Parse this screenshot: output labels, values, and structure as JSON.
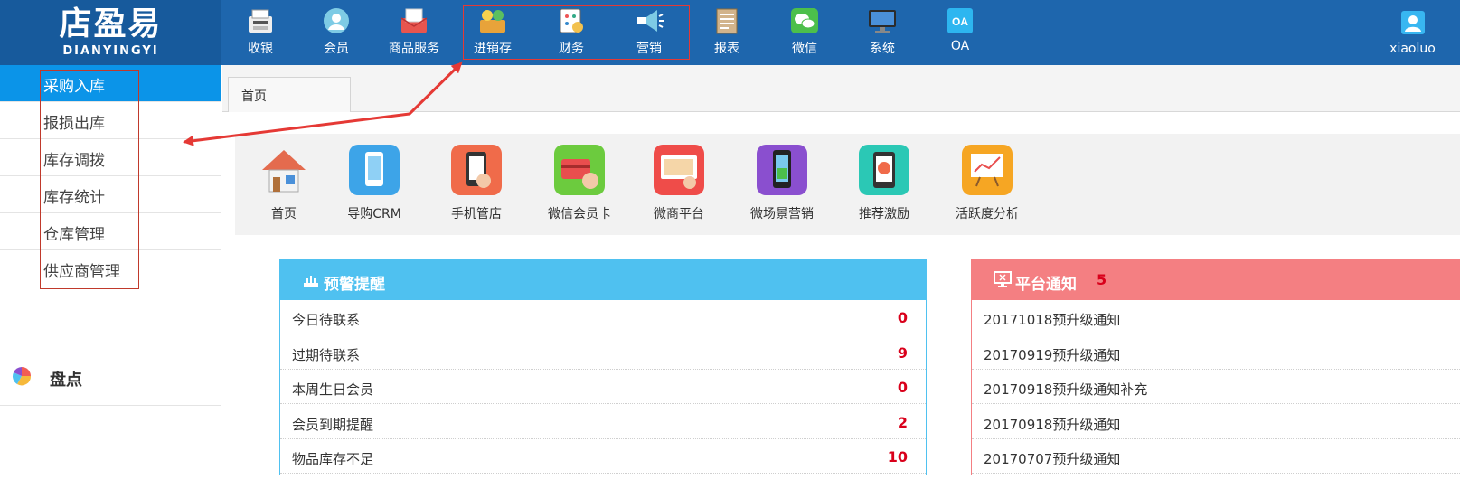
{
  "logo": {
    "main": "店盈易",
    "sub": "DIANYINGYI"
  },
  "nav": [
    {
      "label": "收银",
      "icon": "cash-register-icon",
      "color": "#f2c14e"
    },
    {
      "label": "会员",
      "icon": "member-icon",
      "color": "#7ecbe5"
    },
    {
      "label": "商品服务",
      "icon": "goods-service-icon",
      "color": "#e8554e"
    },
    {
      "label": "进销存",
      "icon": "inventory-icon",
      "color": "#e8a33a"
    },
    {
      "label": "财务",
      "icon": "finance-icon",
      "color": "#f2c14e"
    },
    {
      "label": "营销",
      "icon": "marketing-icon",
      "color": "#7ecbe5"
    },
    {
      "label": "报表",
      "icon": "report-icon",
      "color": "#d2b48c"
    },
    {
      "label": "微信",
      "icon": "wechat-icon",
      "color": "#4cbf4b"
    },
    {
      "label": "系统",
      "icon": "system-icon",
      "color": "#2b2b2b"
    },
    {
      "label": "OA",
      "icon": "oa-icon",
      "color": "#2db6f0"
    }
  ],
  "user": {
    "name": "xiaoluo"
  },
  "sidebar": {
    "items": [
      {
        "label": "采购入库"
      },
      {
        "label": "报损出库"
      },
      {
        "label": "库存调拨"
      },
      {
        "label": "库存统计"
      },
      {
        "label": "仓库管理"
      },
      {
        "label": "供应商管理"
      }
    ],
    "active_index": 0,
    "group": {
      "label": "盘点",
      "icon": "pie-chart-icon"
    }
  },
  "tabs": [
    {
      "label": "首页"
    }
  ],
  "shortcuts": [
    {
      "label": "首页",
      "icon": "home-icon",
      "color": "#e46b4e"
    },
    {
      "label": "导购CRM",
      "icon": "crm-phone-icon",
      "color": "#3da4e8"
    },
    {
      "label": "手机管店",
      "icon": "mobile-store-icon",
      "color": "#f06b4a"
    },
    {
      "label": "微信会员卡",
      "icon": "member-card-icon",
      "color": "#6ccb3e"
    },
    {
      "label": "微商平台",
      "icon": "micro-shop-icon",
      "color": "#ef4c49"
    },
    {
      "label": "微场景营销",
      "icon": "scene-marketing-icon",
      "color": "#8a4fcf"
    },
    {
      "label": "推荐激励",
      "icon": "referral-icon",
      "color": "#2bc8b5"
    },
    {
      "label": "活跃度分析",
      "icon": "activity-analysis-icon",
      "color": "#f6a623"
    }
  ],
  "warning_panel": {
    "title": "预警提醒",
    "header_color": "#4fc1f0",
    "rows": [
      {
        "label": "今日待联系",
        "value": "0"
      },
      {
        "label": "过期待联系",
        "value": "9"
      },
      {
        "label": "本周生日会员",
        "value": "0"
      },
      {
        "label": "会员到期提醒",
        "value": "2"
      },
      {
        "label": "物品库存不足",
        "value": "10"
      }
    ]
  },
  "notice_panel": {
    "title": "平台通知",
    "count": "5",
    "header_color": "#f47f82",
    "rows": [
      {
        "label": "20171018预升级通知"
      },
      {
        "label": "20170919预升级通知"
      },
      {
        "label": "20170918预升级通知补充"
      },
      {
        "label": "20170918预升级通知"
      },
      {
        "label": "20170707预升级通知"
      }
    ]
  }
}
